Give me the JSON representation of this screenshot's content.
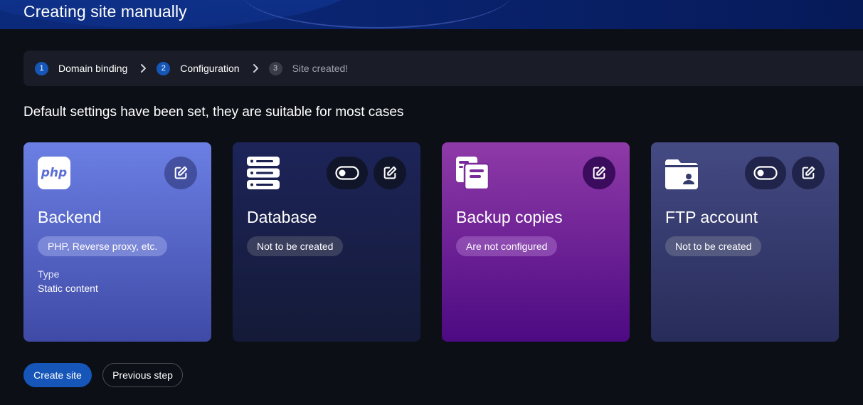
{
  "header": {
    "title": "Creating site manually"
  },
  "stepper": {
    "steps": [
      {
        "num": "1",
        "label": "Domain binding"
      },
      {
        "num": "2",
        "label": "Configuration"
      },
      {
        "num": "3",
        "label": "Site created!"
      }
    ]
  },
  "subtitle": "Default settings have been set, they are suitable for most cases",
  "cards": {
    "backend": {
      "icon_text": "php",
      "title": "Backend",
      "chip": "PHP, Reverse proxy, etc.",
      "type_label": "Type",
      "type_value": "Static content"
    },
    "database": {
      "title": "Database",
      "chip": "Not to be created"
    },
    "backup": {
      "title": "Backup copies",
      "chip": "Are not configured"
    },
    "ftp": {
      "title": "FTP account",
      "chip": "Not to be created"
    }
  },
  "actions": {
    "create_label": "Create site",
    "previous_label": "Previous step"
  },
  "colors": {
    "accent": "#1556b8",
    "background": "#0d0f17"
  }
}
